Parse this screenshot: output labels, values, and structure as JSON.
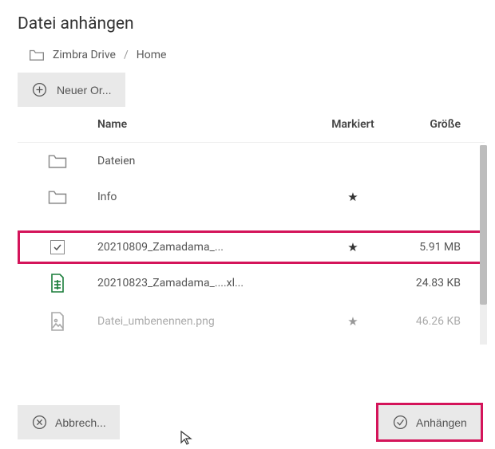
{
  "title": "Datei anhängen",
  "breadcrumb": {
    "root": "Zimbra Drive",
    "current": "Home"
  },
  "toolbar": {
    "new_folder_label": "Neuer Or..."
  },
  "columns": {
    "name": "Name",
    "marked": "Markiert",
    "size": "Größe"
  },
  "rows": [
    {
      "type": "folder",
      "name": "Dateien",
      "marked": false,
      "size": "",
      "selected": false
    },
    {
      "type": "folder",
      "name": "Info",
      "marked": true,
      "size": "",
      "selected": false
    },
    {
      "type": "file",
      "name": "20210809_Zamadama_...",
      "marked": true,
      "size": "5.91 MB",
      "selected": true
    },
    {
      "type": "xls",
      "name": "20210823_Zamadama_....xl...",
      "marked": false,
      "size": "24.83 KB",
      "selected": false
    },
    {
      "type": "image",
      "name": "Datei_umbenennen.png",
      "marked": true,
      "size": "46.26 KB",
      "selected": false
    }
  ],
  "footer": {
    "cancel_label": "Abbrech...",
    "attach_label": "Anhängen"
  }
}
